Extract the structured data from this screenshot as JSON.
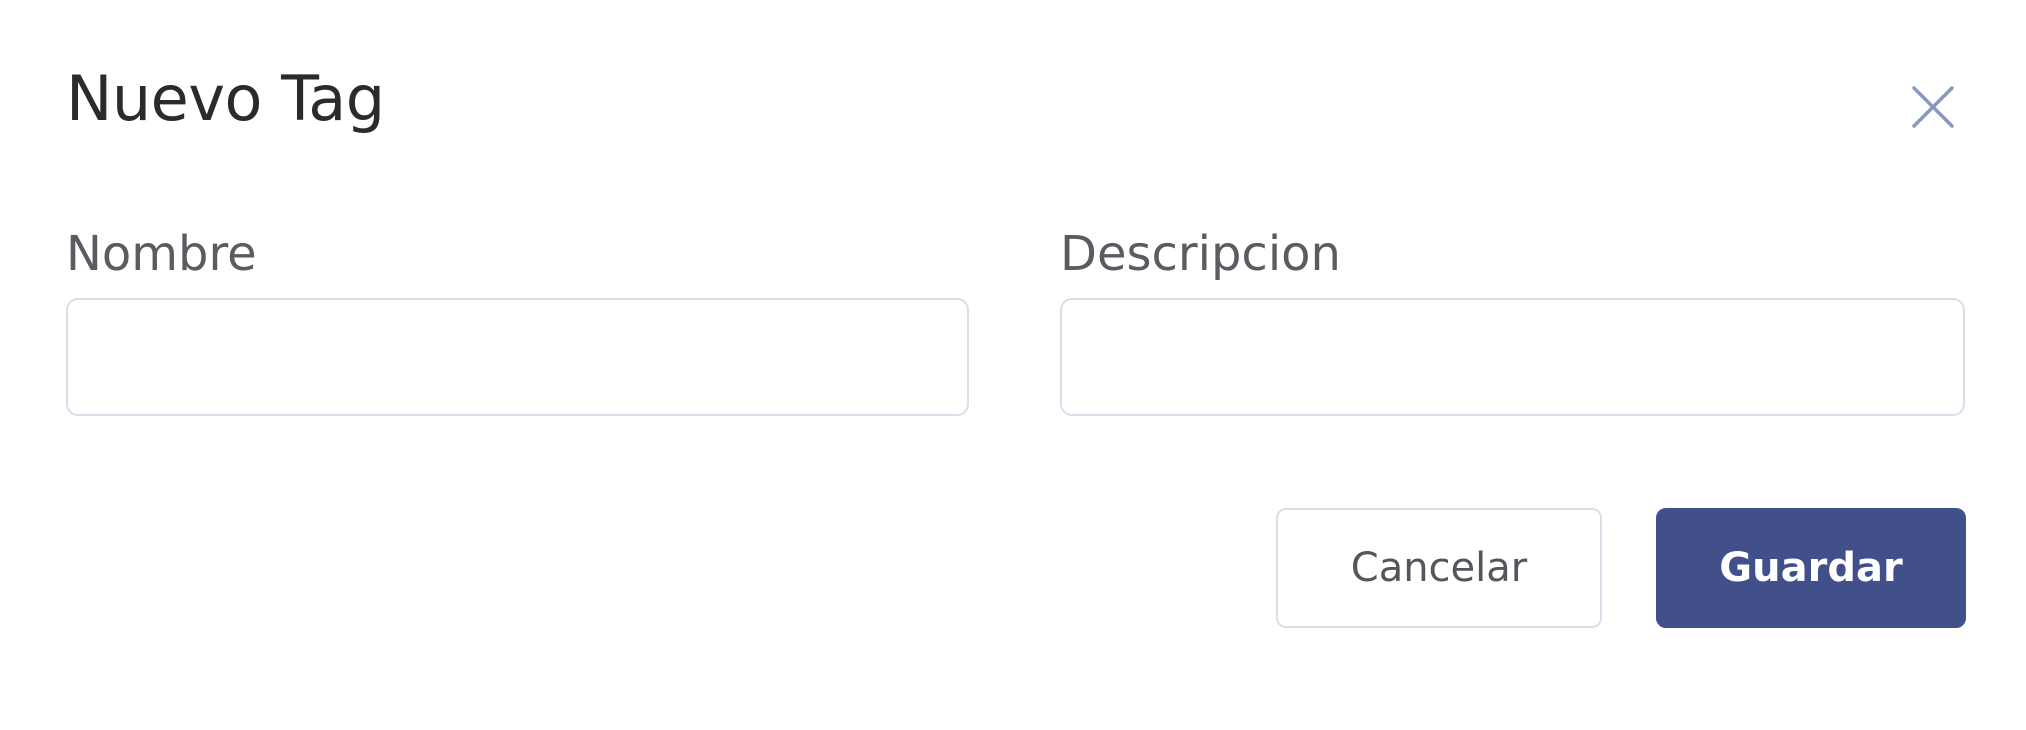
{
  "dialog": {
    "title": "Nuevo Tag",
    "close_icon": "close-icon"
  },
  "form": {
    "nombre": {
      "label": "Nombre",
      "value": "",
      "placeholder": ""
    },
    "descripcion": {
      "label": "Descripcion",
      "value": "",
      "placeholder": ""
    }
  },
  "actions": {
    "cancel_label": "Cancelar",
    "save_label": "Guardar"
  },
  "colors": {
    "primary": "#41508a",
    "close_icon": "#8a97c4",
    "border": "#dcdcea"
  }
}
